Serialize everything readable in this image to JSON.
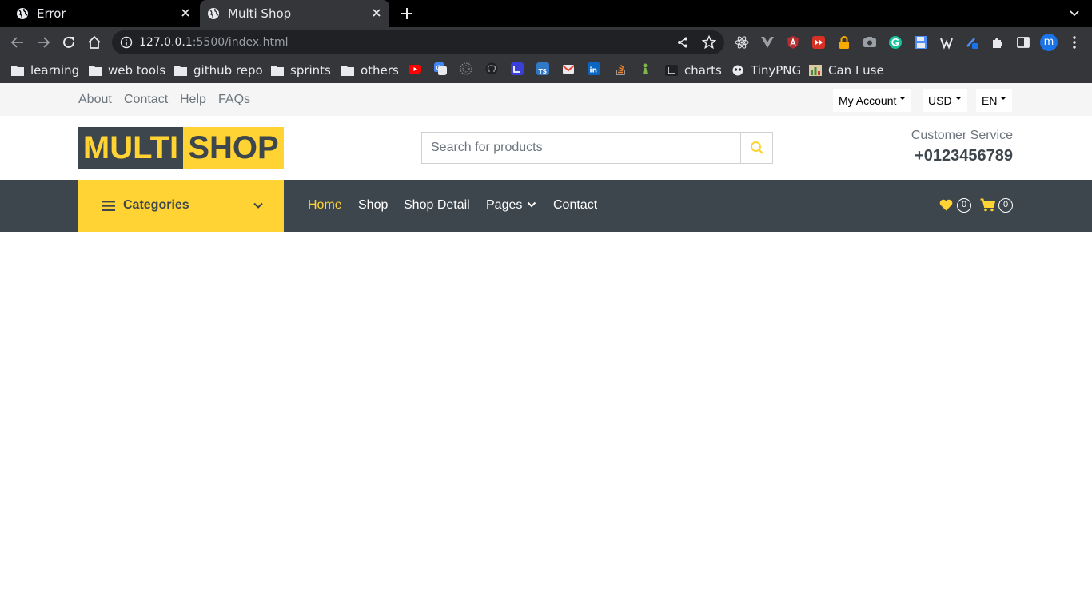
{
  "browser": {
    "tabs": [
      {
        "title": "Error",
        "active": false
      },
      {
        "title": "Multi Shop",
        "active": true
      }
    ],
    "url_host": "127.0.0.1",
    "url_rest": ":5500/index.html",
    "profile_initial": "m",
    "bookmarks": [
      "learning",
      "web tools",
      "github repo",
      "sprints",
      "others",
      "charts",
      "TinyPNG",
      "Can I use"
    ]
  },
  "topbar": {
    "links": [
      "About",
      "Contact",
      "Help",
      "FAQs"
    ],
    "account": "My Account",
    "currency": "USD",
    "language": "EN"
  },
  "header": {
    "logo_part1": "MULTI",
    "logo_part2": "SHOP",
    "search_placeholder": "Search for products",
    "customer_service_label": "Customer Service",
    "phone": "+0123456789"
  },
  "nav": {
    "categories_label": "Categories",
    "links": [
      "Home",
      "Shop",
      "Shop Detail",
      "Pages",
      "Contact"
    ],
    "wishlist_count": "0",
    "cart_count": "0"
  },
  "colors": {
    "primary": "#ffd333",
    "dark": "#3d464d",
    "muted": "#6c757d",
    "topbar_bg": "#f5f5f5"
  }
}
